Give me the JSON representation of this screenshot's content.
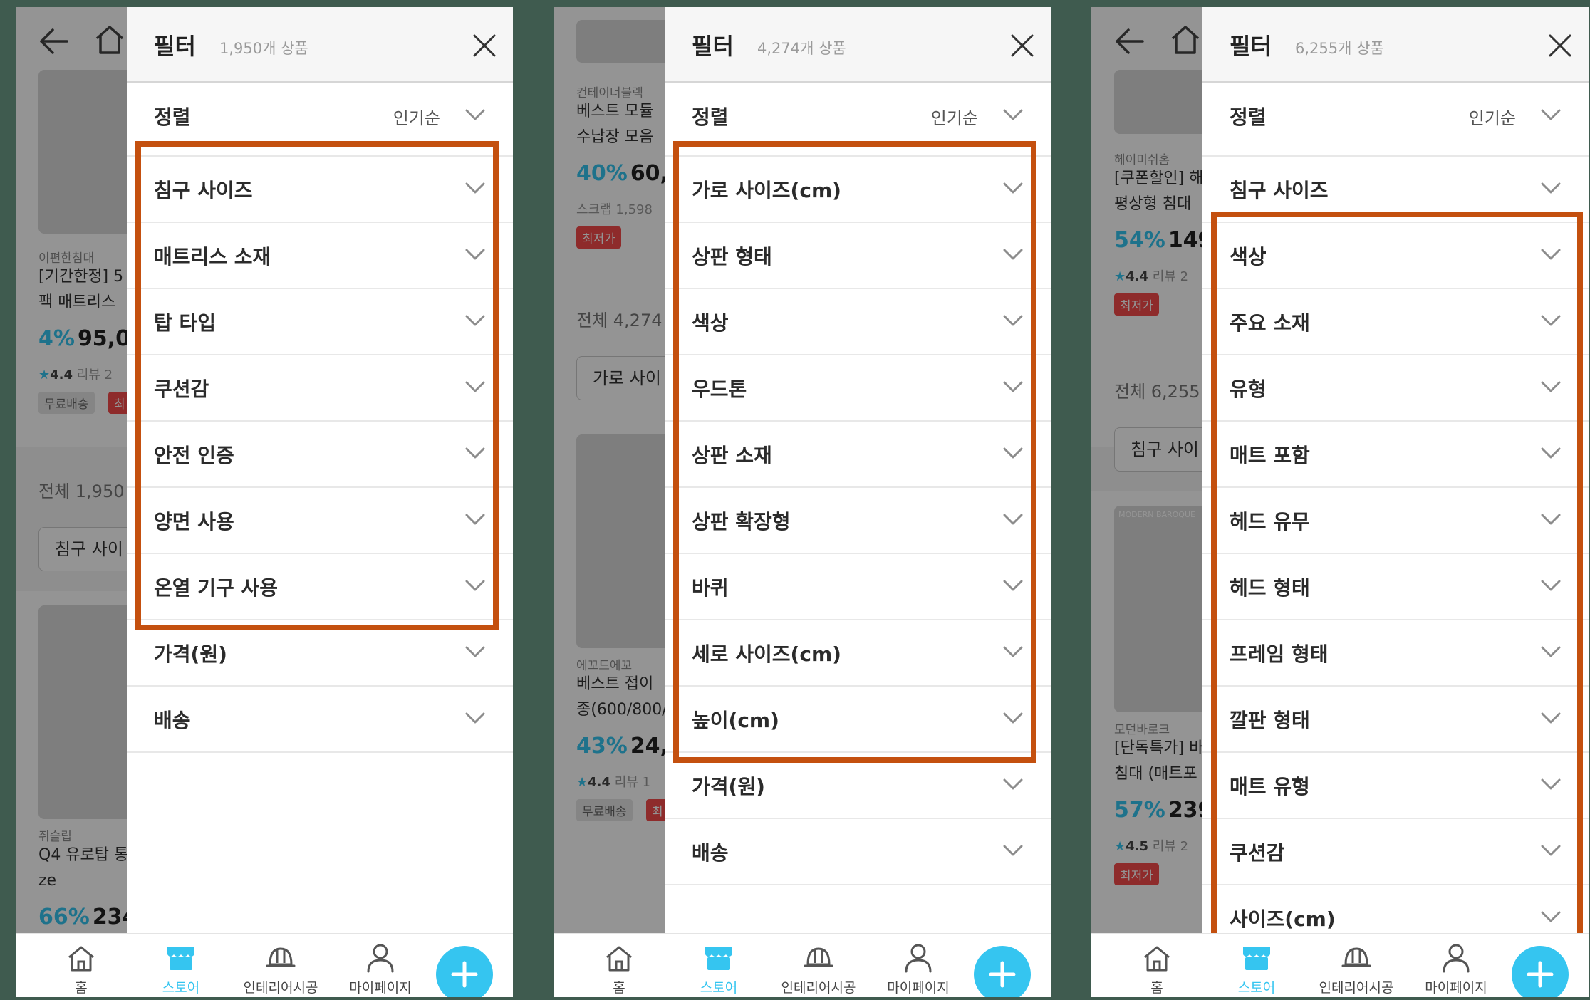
{
  "colors": {
    "accent": "#35c5f0",
    "highlight_box": "#c4500f",
    "sale_tag": "#f44a4a",
    "frame_background": "#3f5b4f"
  },
  "nav": {
    "items": [
      "홈",
      "스토어",
      "인테리어시공",
      "마이페이지"
    ],
    "active": "스토어",
    "fab_icon": "plus-icon"
  },
  "panels": [
    {
      "title": "필터",
      "count": "1,950개 상품",
      "sort": {
        "label": "정렬",
        "value": "인기순"
      },
      "filters": [
        "침구 사이즈",
        "매트리스 소재",
        "탑 타입",
        "쿠션감",
        "안전 인증",
        "양면 사용",
        "온열 기구 사용",
        "가격(원)",
        "배송"
      ],
      "highlight": {
        "first": 0,
        "last": 6
      },
      "background": {
        "brand": "이편한침대",
        "name": [
          "[기간한정] 5",
          "팩 매트리스"
        ],
        "discount": "4%",
        "price": "95,00",
        "rating": "4.4",
        "review": "리뷰 2",
        "tags": [
          "무료배송",
          "최"
        ],
        "total": "전체 1,950",
        "chip": "침구 사이",
        "brand2": "쥐슬립",
        "name2": [
          "Q4 유로탑 통",
          "ze"
        ],
        "discount2": "66%",
        "price2": "234"
      }
    },
    {
      "title": "필터",
      "count": "4,274개 상품",
      "sort": {
        "label": "정렬",
        "value": "인기순"
      },
      "filters": [
        "가로 사이즈(cm)",
        "상판 형태",
        "색상",
        "우드톤",
        "상판 소재",
        "상판 확장형",
        "바퀴",
        "세로 사이즈(cm)",
        "높이(cm)",
        "가격(원)",
        "배송"
      ],
      "highlight": {
        "first": 0,
        "last": 8
      },
      "background": {
        "brand": "컨테이너블랙",
        "name": [
          "베스트 모듈",
          "수납장 모음"
        ],
        "discount": "40%",
        "price": "60,0",
        "rating_line": "스크랩 1,598",
        "tags": [
          "최저가"
        ],
        "total": "전체 4,274",
        "chip": "가로 사이",
        "brand2": "에꼬드에꼬",
        "name2": [
          "베스트 접이",
          "종(600/800/1"
        ],
        "discount2": "43%",
        "price2": "24,9",
        "rating2": "4.4",
        "review2": "리뷰 1",
        "tags2": [
          "무료배송",
          "최"
        ]
      }
    },
    {
      "title": "필터",
      "count": "6,255개 상품",
      "sort": {
        "label": "정렬",
        "value": "인기순"
      },
      "filters": [
        "침구 사이즈",
        "색상",
        "주요 소재",
        "유형",
        "매트 포함",
        "헤드 유무",
        "헤드 형태",
        "프레임 형태",
        "깔판 형태",
        "매트 유형",
        "쿠션감",
        "사이즈(cm)"
      ],
      "highlight": {
        "first": 1,
        "last": 11
      },
      "background": {
        "brand": "헤이미쉬홈",
        "name": [
          "[쿠폰할인] 해",
          "평상형 침대"
        ],
        "discount": "54%",
        "price": "149",
        "rating": "4.4",
        "review": "리뷰 2",
        "tags": [
          "최저가"
        ],
        "total": "전체 6,255",
        "chip": "침구 사이",
        "image_text": "MODERN BAROQUE",
        "brand2": "모던바로크",
        "name2": [
          "[단독특가] 바",
          "침대 (매트포"
        ],
        "discount2": "57%",
        "price2": "239",
        "rating2": "4.5",
        "review2": "리뷰 2",
        "tags2": [
          "최저가"
        ]
      }
    }
  ]
}
